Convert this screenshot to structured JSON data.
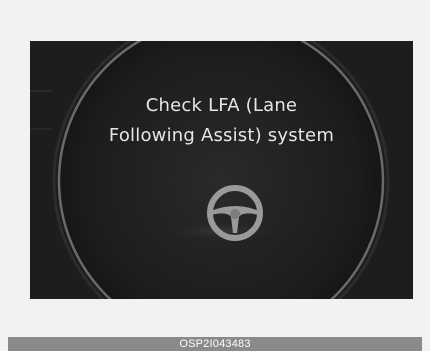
{
  "display": {
    "message_line1": "Check LFA (Lane",
    "message_line2": "Following Assist) system",
    "icon": "steering-wheel-icon"
  },
  "caption": {
    "code": "OSP2I043483"
  },
  "colors": {
    "screen_bg": "#1e1e1f",
    "dial_ring": "#6a6a6a",
    "text": "#e6e6e6",
    "caption_bar": "#8a8a8a"
  }
}
